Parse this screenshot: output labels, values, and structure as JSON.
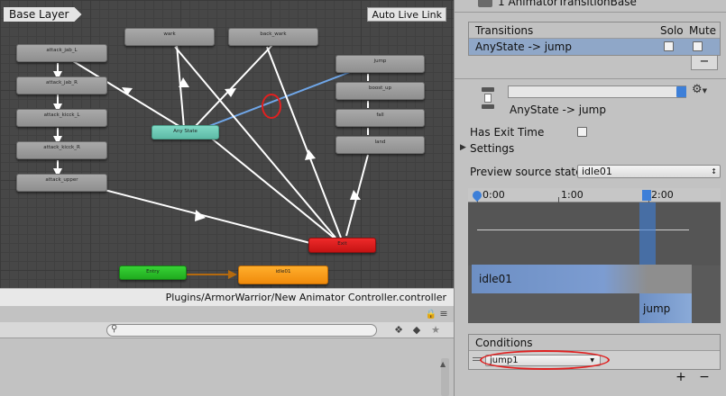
{
  "graph": {
    "layer_tab": "Base Layer",
    "live_link_button": "Auto Live Link",
    "footer_path": "Plugins/ArmorWarrior/New Animator Controller.controller",
    "states": [
      {
        "key": "attack_jab_L",
        "label": "attack_jab_L",
        "kind": "normal"
      },
      {
        "key": "attack_jab_R",
        "label": "attack_jab_R",
        "kind": "normal"
      },
      {
        "key": "attack_kicck_L",
        "label": "attack_kicck_L",
        "kind": "normal"
      },
      {
        "key": "attack_kicck_R",
        "label": "attack_kicck_R",
        "kind": "normal"
      },
      {
        "key": "attack_upper",
        "label": "attack_upper",
        "kind": "normal"
      },
      {
        "key": "wark",
        "label": "wark",
        "kind": "normal"
      },
      {
        "key": "back_wark",
        "label": "back_wark",
        "kind": "normal"
      },
      {
        "key": "jump",
        "label": "jump",
        "kind": "normal"
      },
      {
        "key": "boost_up",
        "label": "boost_up",
        "kind": "normal"
      },
      {
        "key": "fall",
        "label": "fall",
        "kind": "normal"
      },
      {
        "key": "land",
        "label": "land",
        "kind": "normal"
      },
      {
        "key": "any_state",
        "label": "Any State",
        "kind": "any"
      },
      {
        "key": "exit",
        "label": "Exit",
        "kind": "exit"
      },
      {
        "key": "entry",
        "label": "Entry",
        "kind": "entry"
      },
      {
        "key": "idle01",
        "label": "idle01",
        "kind": "default"
      }
    ]
  },
  "inspector": {
    "header_title": "1 AnimatorTransitionBase",
    "transitions_header": "Transitions",
    "solo_label": "Solo",
    "mute_label": "Mute",
    "transition_item": "AnyState -> jump",
    "minus_button": "−",
    "name_field_value": "",
    "transition_subtitle": "AnyState -> jump",
    "has_exit_time_label": "Has Exit Time",
    "settings_label": "Settings",
    "preview_label": "Preview source state",
    "preview_value": "idle01",
    "timeline_ticks": [
      "0:00",
      "1:00",
      "2:00"
    ],
    "source_clip": "idle01",
    "dest_clip": "jump",
    "conditions_header": "Conditions",
    "condition_param": "jump1",
    "plus_button": "+",
    "minus_button_2": "−"
  },
  "colors": {
    "any_state_transition": "#6fa6e8",
    "highlight_circle": "#e02020",
    "entry_transition": "#b56a0e",
    "selection": "#3d7fd8"
  }
}
